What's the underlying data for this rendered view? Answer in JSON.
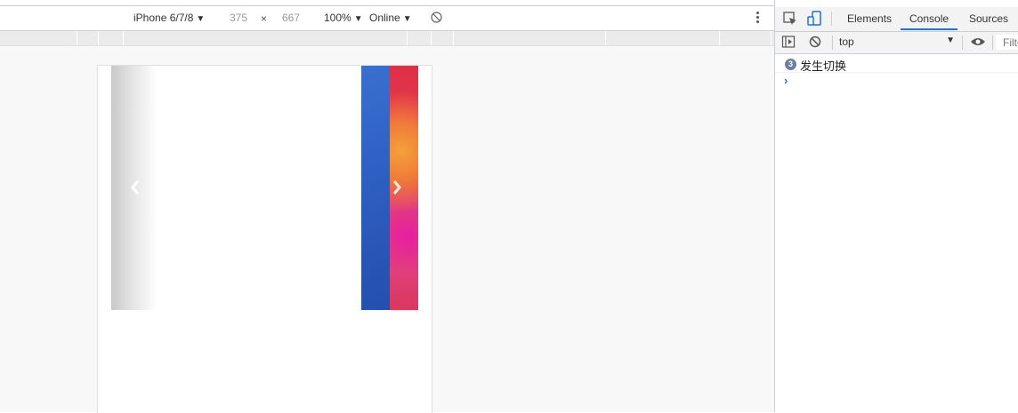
{
  "device_toolbar": {
    "device": "iPhone 6/7/8",
    "width": "375",
    "times": "×",
    "height": "667",
    "zoom": "100%",
    "network": "Online"
  },
  "devtools": {
    "tabs": [
      "Elements",
      "Console",
      "Sources"
    ],
    "active_tab": "Console"
  },
  "console": {
    "context": "top",
    "filter_placeholder": "Filter",
    "messages": [
      {
        "count": "3",
        "text": "发生切换"
      }
    ],
    "prompt": "›"
  },
  "colors": {
    "accent": "#1a73e8",
    "slide_blue": "#2c5ec0",
    "slide_red": "#e03048"
  }
}
